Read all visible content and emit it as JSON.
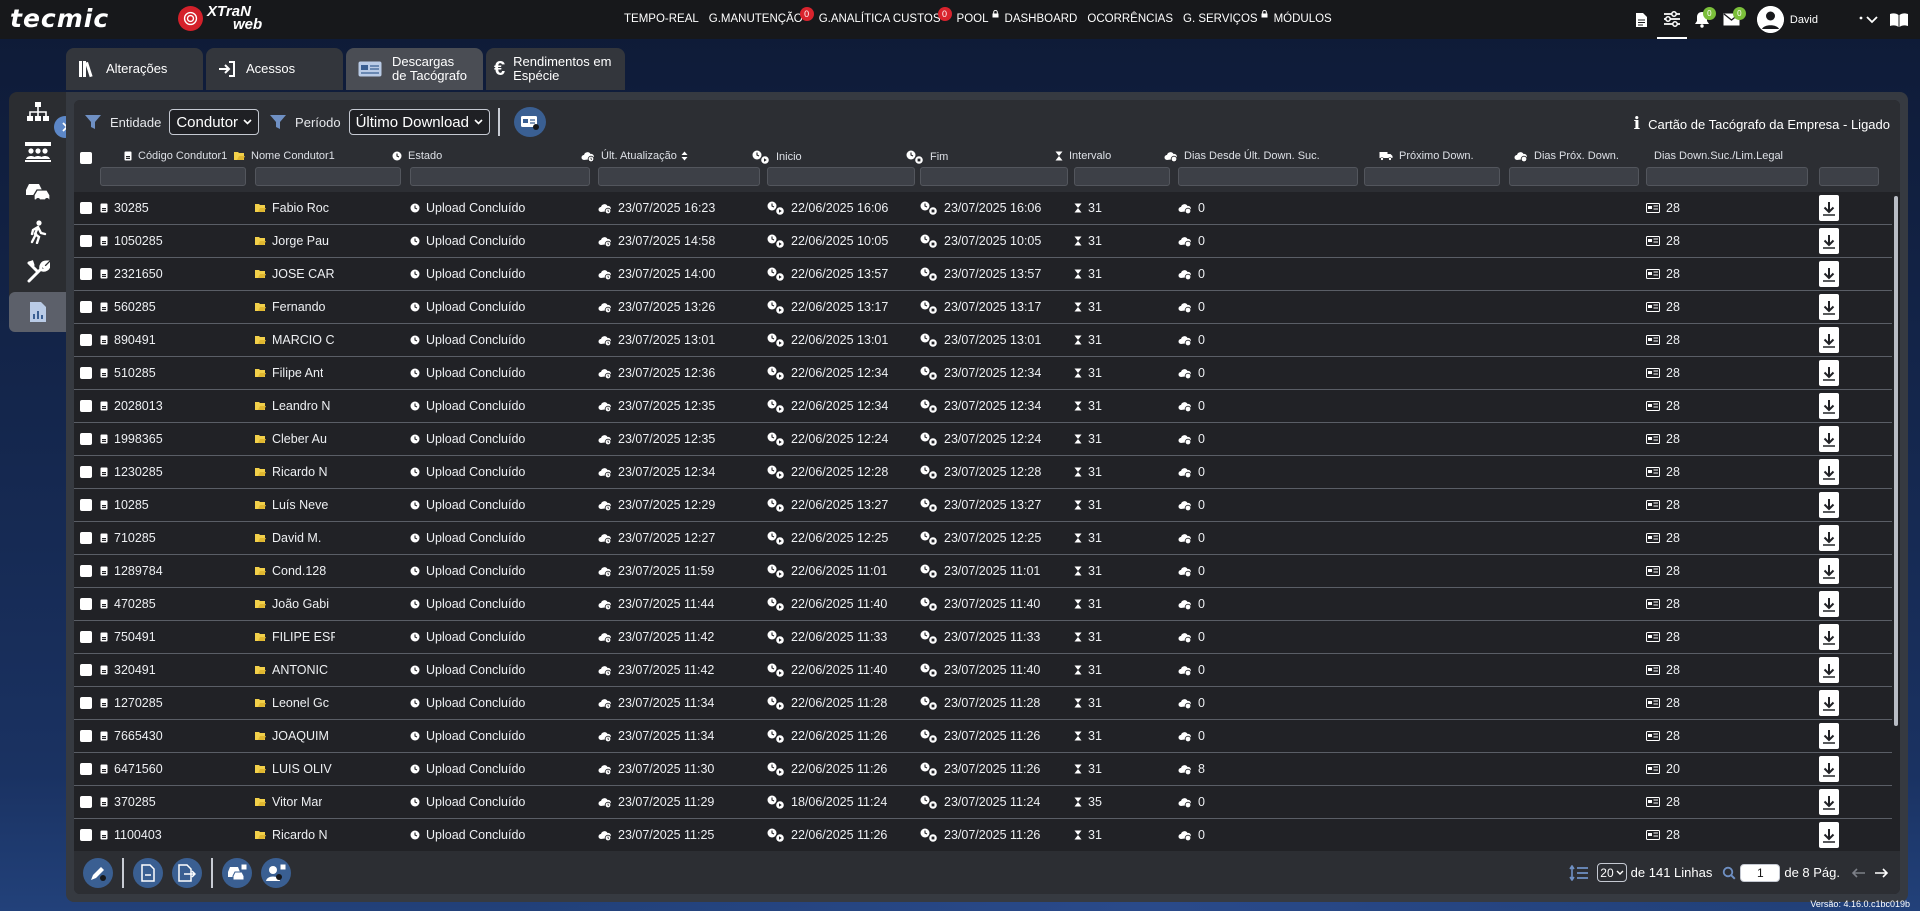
{
  "brand": {
    "tecmic": "tecmic",
    "xtran_line1": "XTraN",
    "xtran_line2": "web"
  },
  "nav": [
    {
      "label": "TEMPO-REAL"
    },
    {
      "label": "G.MANUTENÇÃO",
      "badge": "0"
    },
    {
      "label": "G.ANALÍTICA CUSTOS",
      "badge": "0"
    },
    {
      "label": "POOL",
      "lock": true
    },
    {
      "label": "DASHBOARD"
    },
    {
      "label": "OCORRÊNCIAS"
    },
    {
      "label": "G. SERVIÇOS",
      "lock": true
    },
    {
      "label": "MÓDULOS"
    }
  ],
  "topright": {
    "notif_badge": "0",
    "mail_badge": "0",
    "user": "David"
  },
  "tabs": [
    {
      "label": "Alterações",
      "icon": "books-icon"
    },
    {
      "label": "Acessos",
      "icon": "sign-in-icon"
    },
    {
      "label": "Descargas de Tacógrafo",
      "icon": "tachograph-card-icon",
      "active": true
    },
    {
      "label": "Rendimentos em Espécie",
      "icon": "euro-icon"
    }
  ],
  "sidebar": [
    {
      "name": "hierarchy"
    },
    {
      "name": "people-group"
    },
    {
      "name": "vehicles"
    },
    {
      "name": "walking-person"
    },
    {
      "name": "tools"
    },
    {
      "name": "report",
      "active": true
    }
  ],
  "filters": {
    "entity_label": "Entidade",
    "entity_value": "Condutor",
    "period_label": "Período",
    "period_value": "Último Download",
    "card_info": "Cartão de Tacógrafo da Empresa - Ligado"
  },
  "columns": [
    "Código Condutor1",
    "Nome Condutor1",
    "Estado",
    "Últ. Atualização",
    "Inicio",
    "Fim",
    "Intervalo",
    "Dias Desde Últ. Down. Suc.",
    "Próximo Down.",
    "Dias Próx. Down.",
    "Dias Down.Suc./Lim.Legal"
  ],
  "rows": [
    {
      "code": "30285",
      "name": "Fabio Roc",
      "status": "Upload Concluído",
      "updated": "23/07/2025 16:23",
      "start": "22/06/2025 16:06",
      "end": "23/07/2025 16:06",
      "interval": "31",
      "days_since": "0",
      "legal": "28"
    },
    {
      "code": "1050285",
      "name": "Jorge Pau",
      "status": "Upload Concluído",
      "updated": "23/07/2025 14:58",
      "start": "22/06/2025 10:05",
      "end": "23/07/2025 10:05",
      "interval": "31",
      "days_since": "0",
      "legal": "28"
    },
    {
      "code": "2321650",
      "name": "JOSE CAR",
      "status": "Upload Concluído",
      "updated": "23/07/2025 14:00",
      "start": "22/06/2025 13:57",
      "end": "23/07/2025 13:57",
      "interval": "31",
      "days_since": "0",
      "legal": "28"
    },
    {
      "code": "560285",
      "name": "Fernando",
      "status": "Upload Concluído",
      "updated": "23/07/2025 13:26",
      "start": "22/06/2025 13:17",
      "end": "23/07/2025 13:17",
      "interval": "31",
      "days_since": "0",
      "legal": "28"
    },
    {
      "code": "890491",
      "name": "MARCIO C",
      "status": "Upload Concluído",
      "updated": "23/07/2025 13:01",
      "start": "22/06/2025 13:01",
      "end": "23/07/2025 13:01",
      "interval": "31",
      "days_since": "0",
      "legal": "28"
    },
    {
      "code": "510285",
      "name": "Filipe Ant",
      "status": "Upload Concluído",
      "updated": "23/07/2025 12:36",
      "start": "22/06/2025 12:34",
      "end": "23/07/2025 12:34",
      "interval": "31",
      "days_since": "0",
      "legal": "28"
    },
    {
      "code": "2028013",
      "name": "Leandro N",
      "status": "Upload Concluído",
      "updated": "23/07/2025 12:35",
      "start": "22/06/2025 12:34",
      "end": "23/07/2025 12:34",
      "interval": "31",
      "days_since": "0",
      "legal": "28"
    },
    {
      "code": "1998365",
      "name": "Cleber Au",
      "status": "Upload Concluído",
      "updated": "23/07/2025 12:35",
      "start": "22/06/2025 12:24",
      "end": "23/07/2025 12:24",
      "interval": "31",
      "days_since": "0",
      "legal": "28"
    },
    {
      "code": "1230285",
      "name": "Ricardo N",
      "status": "Upload Concluído",
      "updated": "23/07/2025 12:34",
      "start": "22/06/2025 12:28",
      "end": "23/07/2025 12:28",
      "interval": "31",
      "days_since": "0",
      "legal": "28"
    },
    {
      "code": "10285",
      "name": "Luís Neve",
      "status": "Upload Concluído",
      "updated": "23/07/2025 12:29",
      "start": "22/06/2025 13:27",
      "end": "23/07/2025 13:27",
      "interval": "31",
      "days_since": "0",
      "legal": "28"
    },
    {
      "code": "710285",
      "name": "David M.",
      "status": "Upload Concluído",
      "updated": "23/07/2025 12:27",
      "start": "22/06/2025 12:25",
      "end": "23/07/2025 12:25",
      "interval": "31",
      "days_since": "0",
      "legal": "28"
    },
    {
      "code": "1289784",
      "name": "Cond.128",
      "status": "Upload Concluído",
      "updated": "23/07/2025 11:59",
      "start": "22/06/2025 11:01",
      "end": "23/07/2025 11:01",
      "interval": "31",
      "days_since": "0",
      "legal": "28"
    },
    {
      "code": "470285",
      "name": "João Gabi",
      "status": "Upload Concluído",
      "updated": "23/07/2025 11:44",
      "start": "22/06/2025 11:40",
      "end": "23/07/2025 11:40",
      "interval": "31",
      "days_since": "0",
      "legal": "28"
    },
    {
      "code": "750491",
      "name": "FILIPE ESF",
      "status": "Upload Concluído",
      "updated": "23/07/2025 11:42",
      "start": "22/06/2025 11:33",
      "end": "23/07/2025 11:33",
      "interval": "31",
      "days_since": "0",
      "legal": "28"
    },
    {
      "code": "320491",
      "name": "ANTONIC",
      "status": "Upload Concluído",
      "updated": "23/07/2025 11:42",
      "start": "22/06/2025 11:40",
      "end": "23/07/2025 11:40",
      "interval": "31",
      "days_since": "0",
      "legal": "28"
    },
    {
      "code": "1270285",
      "name": "Leonel Gc",
      "status": "Upload Concluído",
      "updated": "23/07/2025 11:34",
      "start": "22/06/2025 11:28",
      "end": "23/07/2025 11:28",
      "interval": "31",
      "days_since": "0",
      "legal": "28"
    },
    {
      "code": "7665430",
      "name": "JOAQUIM",
      "status": "Upload Concluído",
      "updated": "23/07/2025 11:34",
      "start": "22/06/2025 11:26",
      "end": "23/07/2025 11:26",
      "interval": "31",
      "days_since": "0",
      "legal": "28"
    },
    {
      "code": "6471560",
      "name": "LUIS OLIV",
      "status": "Upload Concluído",
      "updated": "23/07/2025 11:30",
      "start": "22/06/2025 11:26",
      "end": "23/07/2025 11:26",
      "interval": "31",
      "days_since": "8",
      "legal": "20"
    },
    {
      "code": "370285",
      "name": "Vitor Mar",
      "status": "Upload Concluído",
      "updated": "23/07/2025 11:29",
      "start": "18/06/2025 11:24",
      "end": "23/07/2025 11:24",
      "interval": "35",
      "days_since": "0",
      "legal": "28"
    },
    {
      "code": "1100403",
      "name": "Ricardo N",
      "status": "Upload Concluído",
      "updated": "23/07/2025 11:25",
      "start": "22/06/2025 11:26",
      "end": "23/07/2025 11:26",
      "interval": "31",
      "days_since": "0",
      "legal": "28"
    }
  ],
  "pager": {
    "page_size": "20",
    "total_text": "de 141 Linhas",
    "page": "1",
    "pages_text": "de 8 Pág."
  },
  "version": "Versão: 4.16.0.c1bc019b",
  "colors": {
    "accent": "#3a5f92",
    "badge_red": "#d9232d",
    "badge_green": "#7bbf3a",
    "folder": "#f2d04a"
  }
}
